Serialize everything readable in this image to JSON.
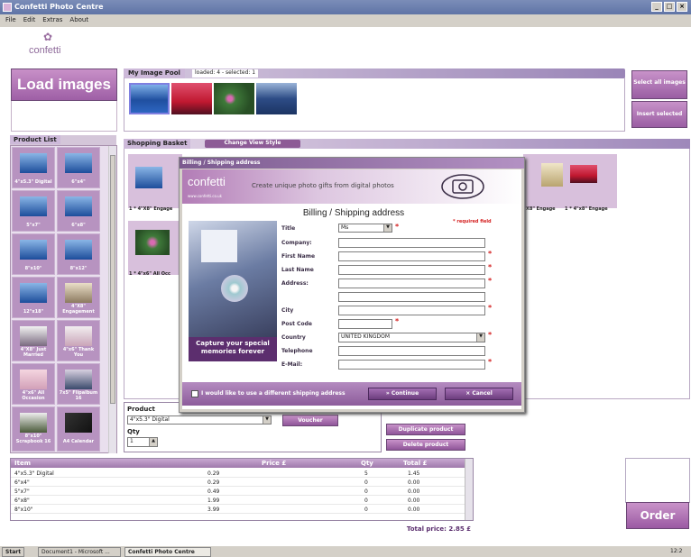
{
  "window": {
    "title": "Confetti Photo Centre",
    "menu": [
      "File",
      "Edit",
      "Extras",
      "About"
    ],
    "controls": [
      "_",
      "□",
      "×"
    ]
  },
  "brand": {
    "logo_text": "confetti"
  },
  "left": {
    "load_images": "Load images"
  },
  "image_pool": {
    "tab": "My Image Pool",
    "status": "loaded: 4 - selected: 1",
    "thumbs": [
      "blue-mountains",
      "red-sunset",
      "flowers",
      "blue-lake"
    ]
  },
  "right_buttons": {
    "select_all": "Select all images",
    "insert_selected": "Insert selected"
  },
  "product_list": {
    "tab": "Product List",
    "items": [
      {
        "label": "4\"x5.3\" Digital"
      },
      {
        "label": "6\"x4\""
      },
      {
        "label": "5\"x7\""
      },
      {
        "label": "6\"x8\""
      },
      {
        "label": "8\"x10\""
      },
      {
        "label": "8\"x12\""
      },
      {
        "label": "12\"x18\""
      },
      {
        "label": "4\"X8\" Engagement"
      },
      {
        "label": "4\"X8\" Just Married"
      },
      {
        "label": "4\"x6\" Thank You"
      },
      {
        "label": "4\"x6\" All Occasion"
      },
      {
        "label": "7x5\" Flipalbum 16"
      },
      {
        "label": "8\"x10\" Scrapbook 16"
      },
      {
        "label": "A4 Calendar"
      }
    ]
  },
  "basket": {
    "tab": "Shopping Basket",
    "view_style": "Change View Style",
    "labels": [
      "1 * 4\"X8\" Engage",
      "1 * 4\"x6\" All Occ",
      "X8\" Engage",
      "1 * 4\"x8\" Engage"
    ]
  },
  "product": {
    "label": "Product",
    "value": "4\"x5.3\" Digital",
    "qty_label": "Qty",
    "qty_value": "1",
    "voucher": "Voucher",
    "duplicate": "Duplicate product",
    "delete": "Delete product"
  },
  "table": {
    "headers": {
      "item": "Item",
      "price": "Price £",
      "qty": "Qty",
      "total": "Total £"
    },
    "rows": [
      {
        "item": "4\"x5.3\" Digital",
        "price": "0.29",
        "qty": "5",
        "total": "1.45"
      },
      {
        "item": "6\"x4\"",
        "price": "0.29",
        "qty": "0",
        "total": "0.00"
      },
      {
        "item": "5\"x7\"",
        "price": "0.49",
        "qty": "0",
        "total": "0.00"
      },
      {
        "item": "6\"x8\"",
        "price": "1.99",
        "qty": "0",
        "total": "0.00"
      },
      {
        "item": "8\"x10\"",
        "price": "3.99",
        "qty": "0",
        "total": "0.00"
      }
    ],
    "total_price": "Total price: 2.85 £"
  },
  "order": "Order",
  "taskbar": {
    "start": "Start",
    "doc": "Document1 - Microsoft ...",
    "app": "Confetti Photo Centre",
    "clock": "12:2"
  },
  "dialog": {
    "title": "Billing / Shipping address",
    "banner_logo": "confetti",
    "banner_url": "www.confetti.co.uk",
    "slogan": "Create unique photo gifts from digital photos",
    "form_title": "Billing / Shipping address",
    "required_note": "* required field",
    "fields": {
      "title": "Title",
      "company": "Company:",
      "first_name": "First Name",
      "last_name": "Last Name",
      "address": "Address:",
      "city": "City",
      "post_code": "Post Code",
      "country": "Country",
      "telephone": "Telephone",
      "email": "E-Mail:"
    },
    "title_value": "Ms",
    "country_value": "UNITED KINGDOM",
    "caption": "Capture your special memories forever",
    "shipping_checkbox": "I would like to use a different shipping address",
    "continue": "Continue",
    "cancel": "Cancel"
  },
  "colors": {
    "accent": "#9e5fa6",
    "dark_purple": "#5c2e6e",
    "required": "#d42020"
  }
}
